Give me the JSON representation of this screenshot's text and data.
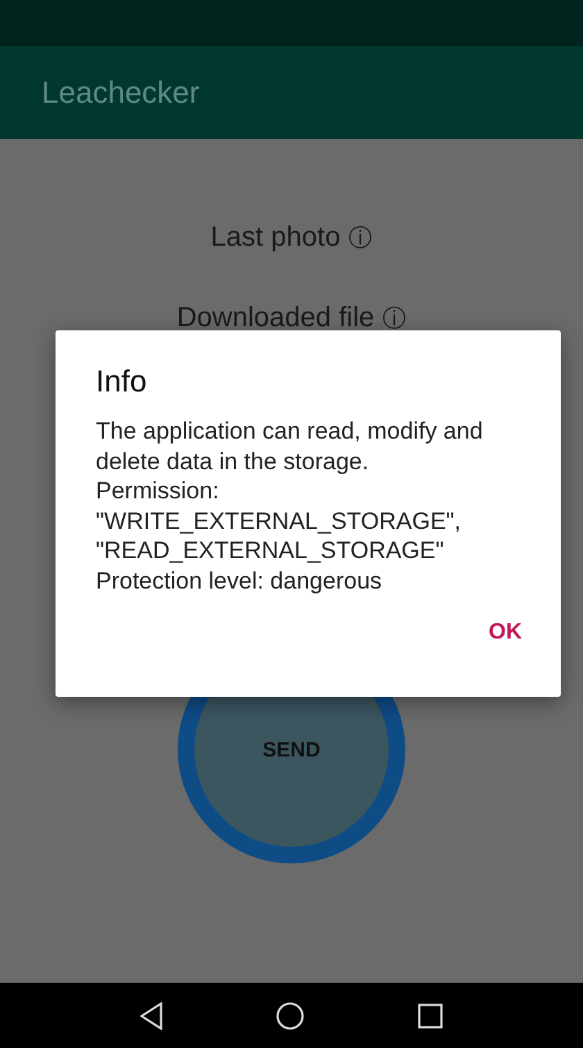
{
  "app_bar": {
    "title": "Leachecker"
  },
  "items": [
    {
      "label": "Last photo",
      "info": "ⓘ"
    },
    {
      "label": "Downloaded file",
      "info": "ⓘ"
    }
  ],
  "send_button": {
    "label": "SEND"
  },
  "dialog": {
    "title": "Info",
    "message": "The application can read, modify and delete data in the storage.\nPermission:\n\"WRITE_EXTERNAL_STORAGE\",\n\"READ_EXTERNAL_STORAGE\"\nProtection level: dangerous",
    "buttons": [
      "OK"
    ]
  }
}
